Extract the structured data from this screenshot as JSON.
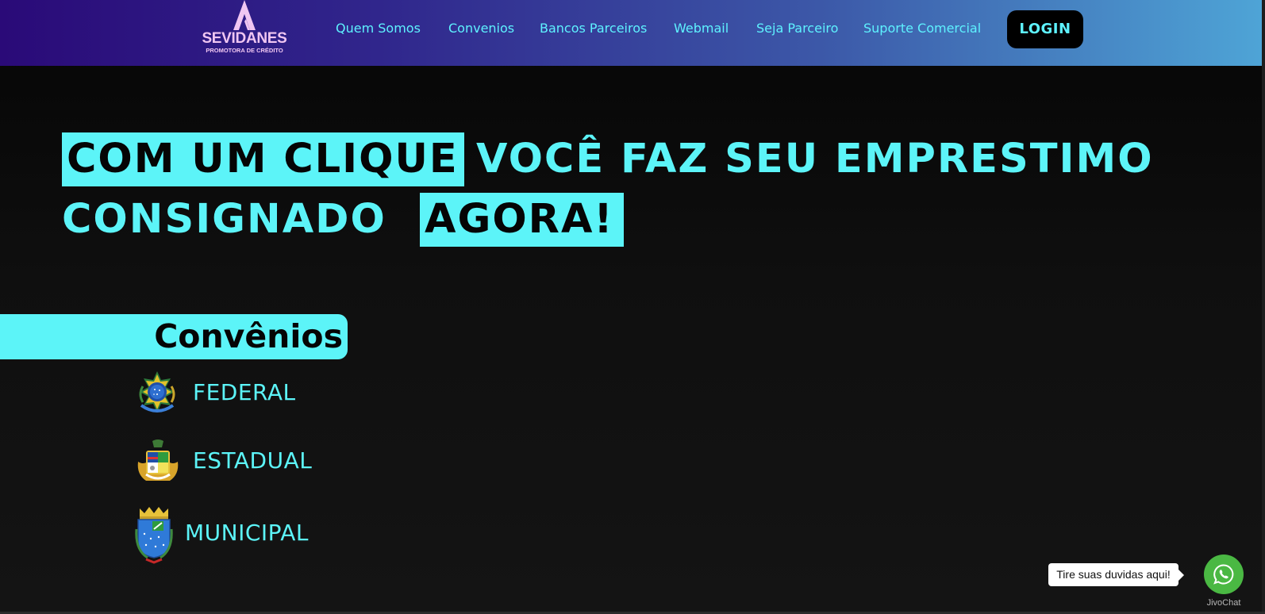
{
  "header": {
    "logo": {
      "name": "SEVIDANES",
      "tagline": "PROMOTORA DE CRÉDITO"
    },
    "nav": [
      {
        "label": "Quem Somos"
      },
      {
        "label": "Convenios"
      },
      {
        "label": "Bancos Parceiros"
      },
      {
        "label": "Webmail"
      },
      {
        "label": "Seja Parceiro"
      },
      {
        "label": "Suporte Comercial"
      }
    ],
    "login_label": "LOGIN"
  },
  "hero": {
    "line1_highlight": "COM UM CLIQUE",
    "line1_rest": "VOCÊ FAZ SEU EMPRESTIMO",
    "line2_rest": "CONSIGNADO",
    "line2_highlight": "AGORA!"
  },
  "convenios": {
    "title": "Convênios",
    "items": [
      {
        "label": "FEDERAL",
        "icon": "brazil-coat-of-arms-icon"
      },
      {
        "label": "ESTADUAL",
        "icon": "state-coat-of-arms-icon"
      },
      {
        "label": "MUNICIPAL",
        "icon": "municipal-coat-of-arms-icon"
      }
    ]
  },
  "chat": {
    "bubble_text": "Tire suas duvidas aqui!",
    "brand": "JivoChat",
    "icon": "whatsapp-icon"
  },
  "colors": {
    "accent": "#5cf4f8",
    "background": "#121212",
    "header_start": "#2a0a78",
    "header_end": "#4ea4d6",
    "chat_green": "#4ab843"
  }
}
